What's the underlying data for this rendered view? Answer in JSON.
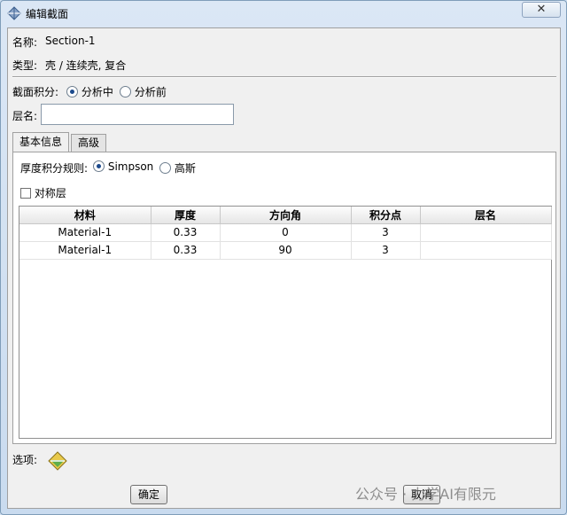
{
  "window": {
    "title": "编辑截面",
    "close_glyph": "✕"
  },
  "section": {
    "name_label": "名称:",
    "name_value": "Section-1",
    "type_label": "类型:",
    "type_value": "壳 / 连续壳, 复合"
  },
  "integration": {
    "label": "截面积分:",
    "options": [
      "分析中",
      "分析前"
    ],
    "selected": "分析中"
  },
  "layer_name": {
    "label": "层名:",
    "value": ""
  },
  "tabs": [
    {
      "label": "基本信息",
      "active": true
    },
    {
      "label": "高级",
      "active": false
    }
  ],
  "thickness_rule": {
    "label": "厚度积分规则:",
    "options": [
      "Simpson",
      "高斯"
    ],
    "selected": "Simpson"
  },
  "symmetric": {
    "label": "对称层",
    "checked": false
  },
  "table": {
    "columns": [
      "材料",
      "厚度",
      "方向角",
      "积分点",
      "层名"
    ],
    "rows": [
      [
        "Material-1",
        "0.33",
        "0",
        "3",
        ""
      ],
      [
        "Material-1",
        "0.33",
        "90",
        "3",
        ""
      ]
    ]
  },
  "options_label": "选项:",
  "buttons": {
    "ok": "确定",
    "cancel": "取消"
  },
  "watermark": "公众号 · 力学AI有限元"
}
